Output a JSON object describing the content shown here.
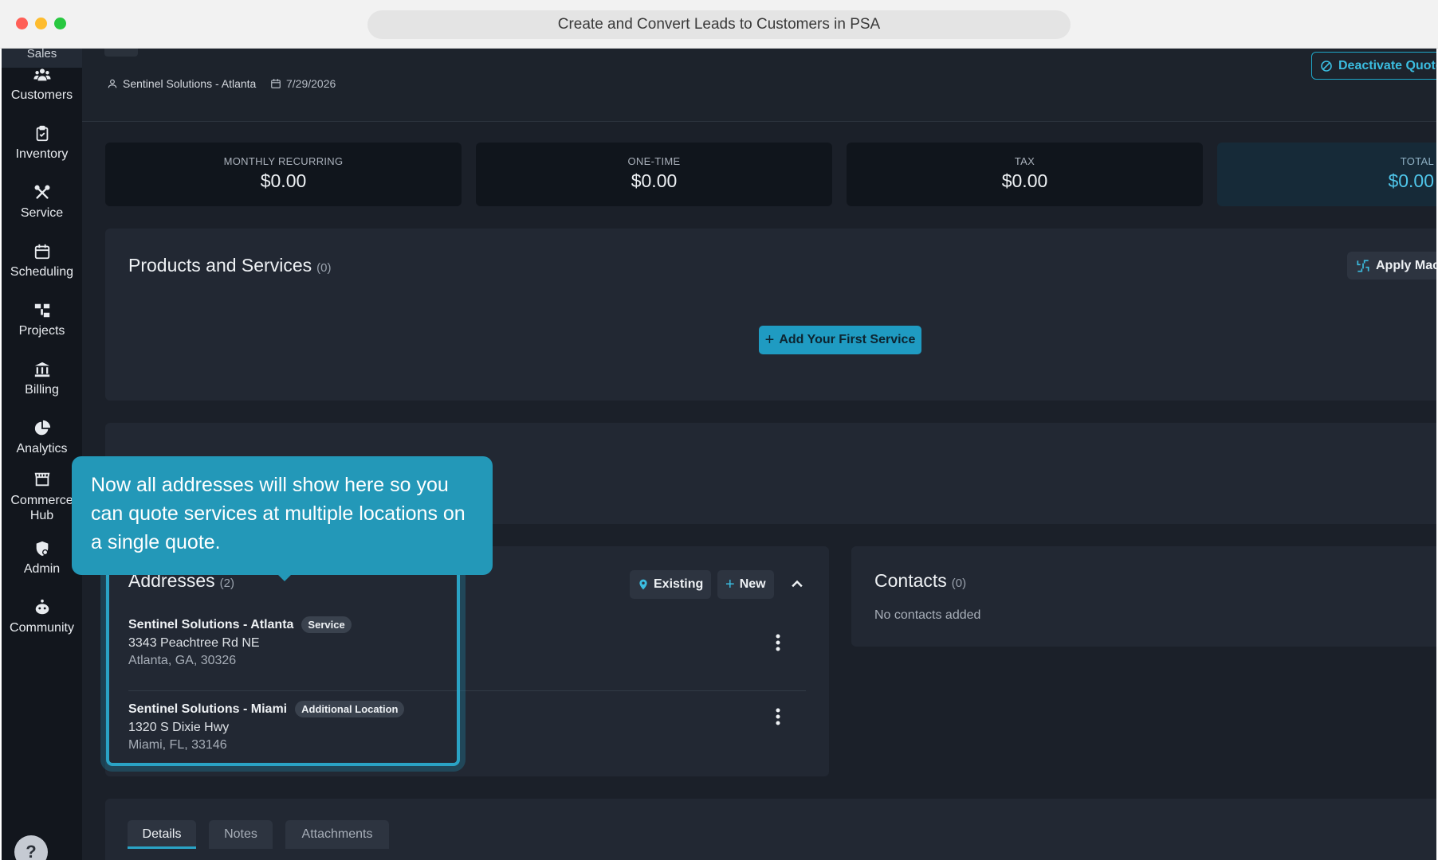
{
  "browser": {
    "title": "Create and Convert Leads to Customers in PSA"
  },
  "sidebar": {
    "partial_item": "Sales",
    "items": [
      {
        "label": "Customers",
        "icon": "users-icon"
      },
      {
        "label": "Inventory",
        "icon": "clipboard-icon"
      },
      {
        "label": "Service",
        "icon": "tools-icon"
      },
      {
        "label": "Scheduling",
        "icon": "calendar-icon"
      },
      {
        "label": "Projects",
        "icon": "hierarchy-icon"
      },
      {
        "label": "Billing",
        "icon": "bank-icon"
      },
      {
        "label": "Analytics",
        "icon": "pie-chart-icon"
      },
      {
        "label": "Commerce Hub",
        "icon": "store-icon"
      },
      {
        "label": "Admin",
        "icon": "shield-user-icon"
      },
      {
        "label": "Community",
        "icon": "community-icon"
      }
    ],
    "help_label": "?"
  },
  "header": {
    "customer": "Sentinel Solutions - Atlanta",
    "date": "7/29/2026",
    "deactivate_label": "Deactivate Quote"
  },
  "stats": [
    {
      "label": "MONTHLY RECURRING",
      "value": "$0.00"
    },
    {
      "label": "ONE-TIME",
      "value": "$0.00"
    },
    {
      "label": "TAX",
      "value": "$0.00"
    },
    {
      "label": "TOTAL",
      "value": "$0.00"
    }
  ],
  "products": {
    "title": "Products and Services",
    "count": "(0)",
    "apply_macro_label": "Apply Macro",
    "add_first_label": "Add Your First Service"
  },
  "addresses": {
    "title": "Addresses",
    "count": "(2)",
    "existing_label": "Existing",
    "new_label": "New",
    "items": [
      {
        "name": "Sentinel Solutions - Atlanta",
        "badge": "Service",
        "street": "3343 Peachtree Rd NE",
        "city": "Atlanta, GA, 30326"
      },
      {
        "name": "Sentinel Solutions - Miami",
        "badge": "Additional Location",
        "street": "1320 S Dixie Hwy",
        "city": "Miami, FL, 33146"
      }
    ]
  },
  "contacts": {
    "title": "Contacts",
    "count": "(0)",
    "empty": "No contacts added"
  },
  "tabs": [
    {
      "label": "Details"
    },
    {
      "label": "Notes"
    },
    {
      "label": "Attachments"
    }
  ],
  "tooltip": {
    "text": "Now all addresses will show here so you can quote services at multiple locations on a single quote."
  },
  "colors": {
    "accent": "#1f9bc2",
    "background": "#1b2029",
    "sidebar": "#12161d",
    "panel": "#222833"
  }
}
